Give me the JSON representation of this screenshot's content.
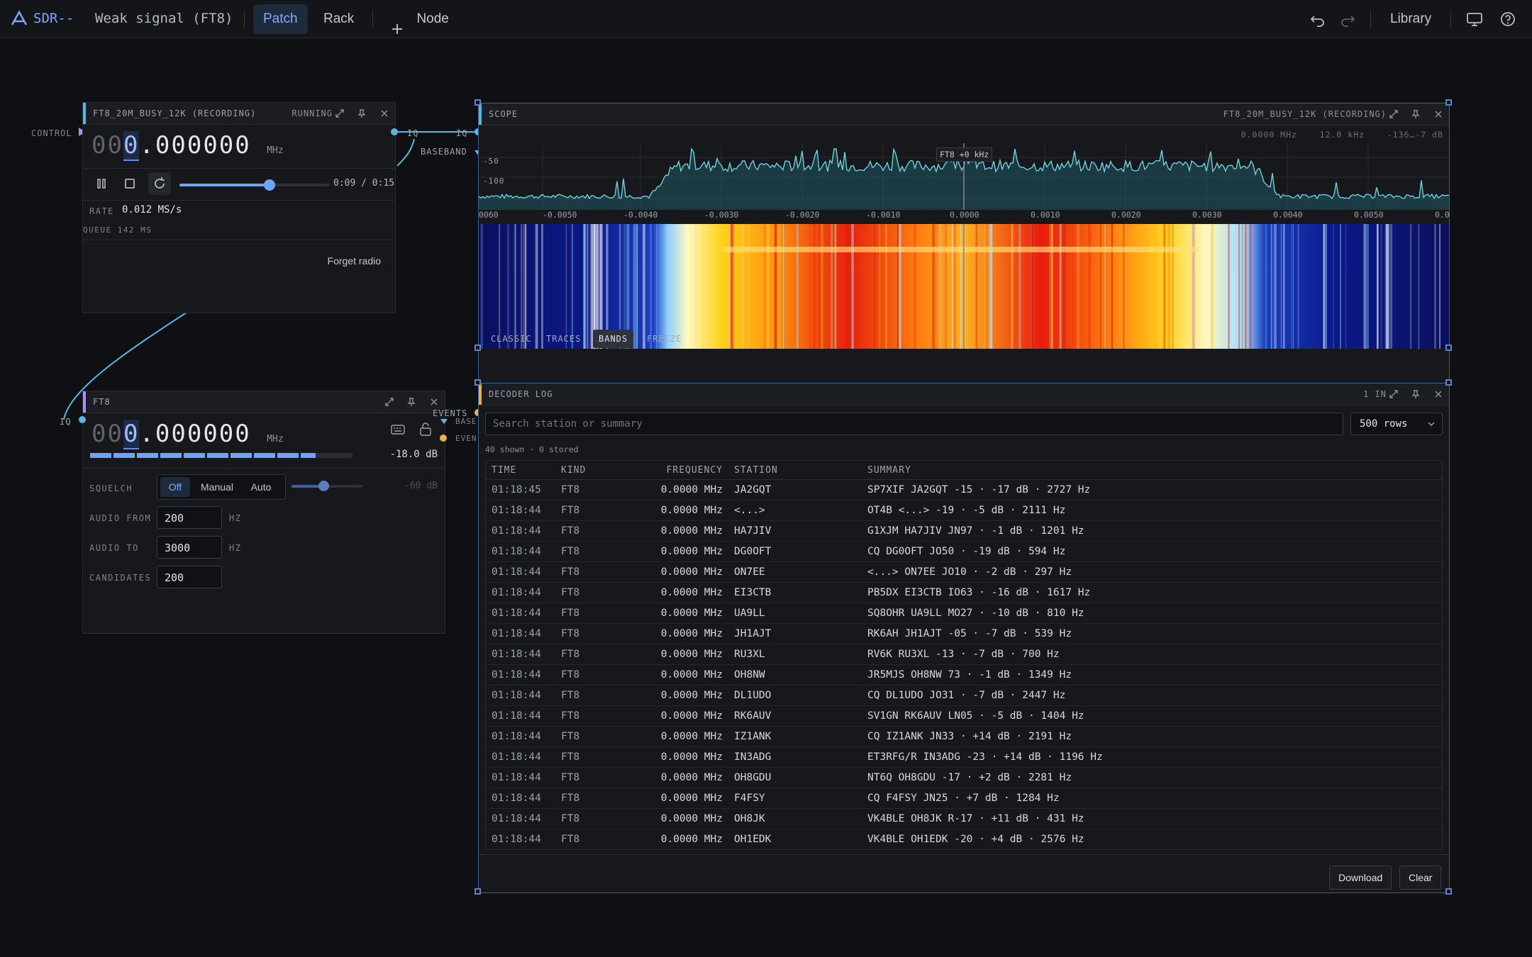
{
  "topbar": {
    "app_name": "SDR--",
    "project_title": "Weak signal (FT8)",
    "tabs": [
      {
        "label": "Patch",
        "active": true
      },
      {
        "label": "Rack",
        "active": false
      }
    ],
    "add_node_label": "Node",
    "library_label": "Library"
  },
  "colors": {
    "accent": "#5b8cff",
    "port_iq": "#58b7e0",
    "port_events": "#e9b247",
    "control": "#b08cff"
  },
  "source_panel": {
    "title": "FT8_20M_BUSY_12K (RECORDING)",
    "status": "RUNNING",
    "control_port_label": "CONTROL",
    "freq_prefix_dim": "00",
    "freq_cursor_digit": "0",
    "freq_rest": ".000000",
    "freq_unit": "MHz",
    "time_display": "0:09 / 0:15",
    "progress_fraction": 0.6,
    "rate_label": "RATE",
    "rate_value": "0.012 MS/s",
    "queue_text": "QUEUE 142 MS",
    "forget_label": "Forget radio",
    "out_port_label": "IQ",
    "baseband_label": "BASEBAND"
  },
  "scope_panel": {
    "title": "SCOPE",
    "source_name": "FT8_20M_BUSY_12K (RECORDING)",
    "in_port_label": "IQ",
    "readout_center": "0.0000 MHz",
    "readout_span": "12.0 kHz",
    "readout_range": "-136…-7 dB",
    "y_ticks": [
      "-50",
      "-100"
    ],
    "marker_label": "FT8 +0 kHz",
    "x_ticks": [
      "0060",
      "-0.0050",
      "-0.0040",
      "-0.0030",
      "-0.0020",
      "-0.0010",
      "0.0000",
      "0.0010",
      "0.0020",
      "0.0030",
      "0.0040",
      "0.0050",
      "0.0"
    ],
    "modes": [
      {
        "label": "CLASSIC",
        "active": false
      },
      {
        "label": "TRACES",
        "active": false
      },
      {
        "label": "BANDS",
        "active": true
      },
      {
        "label": "FREEZE",
        "active": false
      }
    ]
  },
  "ft8_panel": {
    "title": "FT8",
    "in_port_label": "IQ",
    "freq_prefix_dim": "00",
    "freq_cursor_digit": "0",
    "freq_rest": ".000000",
    "freq_unit": "MHz",
    "level_fraction": 0.86,
    "level_text": "-18.0 dB",
    "squelch_label": "SQUELCH",
    "squelch_options": [
      {
        "label": "Off",
        "active": true
      },
      {
        "label": "Manual",
        "active": false
      },
      {
        "label": "Auto",
        "active": false
      }
    ],
    "squelch_fraction": 0.45,
    "squelch_value": "-60 dB",
    "audio_from_label": "AUDIO FROM",
    "audio_from_value": "200",
    "audio_from_unit": "HZ",
    "audio_to_label": "AUDIO TO",
    "audio_to_value": "3000",
    "audio_to_unit": "HZ",
    "candidates_label": "CANDIDATES",
    "candidates_value": "200",
    "out_port_label": "EVENTS",
    "side_label_1": "BASE",
    "side_label_2": "EVEN"
  },
  "log_panel": {
    "title": "DECODER LOG",
    "in_count": "1 IN",
    "search_placeholder": "Search station or summary",
    "rows_select": "500 rows",
    "summary_text": "40 shown · 0 stored",
    "columns": [
      "TIME",
      "KIND",
      "FREQUENCY",
      "STATION",
      "SUMMARY"
    ],
    "rows": [
      [
        "01:18:45",
        "FT8",
        "0.0000 MHz",
        "JA2GQT",
        "SP7XIF JA2GQT -15 · -17 dB · 2727 Hz"
      ],
      [
        "01:18:44",
        "FT8",
        "0.0000 MHz",
        "<...>",
        "OT4B <...> -19 · -5 dB · 2111 Hz"
      ],
      [
        "01:18:44",
        "FT8",
        "0.0000 MHz",
        "HA7JIV",
        "G1XJM HA7JIV JN97 · -1 dB · 1201 Hz"
      ],
      [
        "01:18:44",
        "FT8",
        "0.0000 MHz",
        "DG0OFT",
        "CQ DG0OFT JO50 · -19 dB · 594 Hz"
      ],
      [
        "01:18:44",
        "FT8",
        "0.0000 MHz",
        "ON7EE",
        "<...> ON7EE JO10 · -2 dB · 297 Hz"
      ],
      [
        "01:18:44",
        "FT8",
        "0.0000 MHz",
        "EI3CTB",
        "PB5DX EI3CTB IO63 · -16 dB · 1617 Hz"
      ],
      [
        "01:18:44",
        "FT8",
        "0.0000 MHz",
        "UA9LL",
        "SQ8OHR UA9LL MO27 · -10 dB · 810 Hz"
      ],
      [
        "01:18:44",
        "FT8",
        "0.0000 MHz",
        "JH1AJT",
        "RK6AH JH1AJT -05 · -7 dB · 539 Hz"
      ],
      [
        "01:18:44",
        "FT8",
        "0.0000 MHz",
        "RU3XL",
        "RV6K RU3XL -13 · -7 dB · 700 Hz"
      ],
      [
        "01:18:44",
        "FT8",
        "0.0000 MHz",
        "OH8NW",
        "JR5MJS OH8NW 73 · -1 dB · 1349 Hz"
      ],
      [
        "01:18:44",
        "FT8",
        "0.0000 MHz",
        "DL1UDO",
        "CQ DL1UDO JO31 · -7 dB · 2447 Hz"
      ],
      [
        "01:18:44",
        "FT8",
        "0.0000 MHz",
        "RK6AUV",
        "SV1GN RK6AUV LN05 · -5 dB · 1404 Hz"
      ],
      [
        "01:18:44",
        "FT8",
        "0.0000 MHz",
        "IZ1ANK",
        "CQ IZ1ANK JN33 · +14 dB · 2191 Hz"
      ],
      [
        "01:18:44",
        "FT8",
        "0.0000 MHz",
        "IN3ADG",
        "ET3RFG/R IN3ADG -23 · +14 dB · 1196 Hz"
      ],
      [
        "01:18:44",
        "FT8",
        "0.0000 MHz",
        "OH8GDU",
        "NT6Q OH8GDU -17 · +2 dB · 2281 Hz"
      ],
      [
        "01:18:44",
        "FT8",
        "0.0000 MHz",
        "F4FSY",
        "CQ F4FSY JN25 · +7 dB · 1284 Hz"
      ],
      [
        "01:18:44",
        "FT8",
        "0.0000 MHz",
        "OH8JK",
        "VK4BLE OH8JK R-17 · +11 dB · 431 Hz"
      ],
      [
        "01:18:44",
        "FT8",
        "0.0000 MHz",
        "OH1EDK",
        "VK4BLE OH1EDK -20 · +4 dB · 2576 Hz"
      ]
    ],
    "download_label": "Download",
    "clear_label": "Clear"
  }
}
